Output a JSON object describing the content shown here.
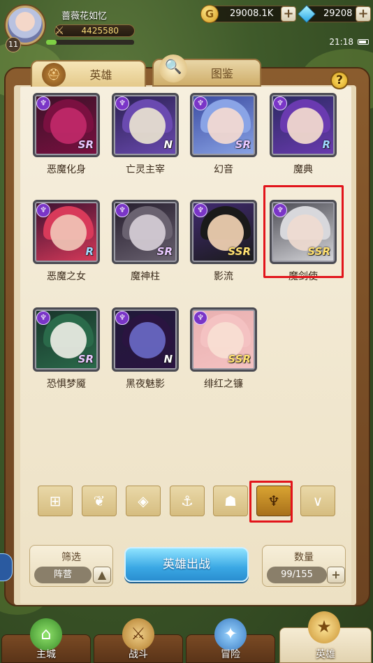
{
  "player": {
    "name": "蔷薇花如忆",
    "level": "11",
    "power": "4425580",
    "exp_fraction": 0.12
  },
  "resources": {
    "gold": "29008.1K",
    "gems": "29208"
  },
  "clock": "21:18",
  "tabs": {
    "hero": "英雄",
    "dex": "图鉴"
  },
  "help": "?",
  "heroes": [
    {
      "name": "恶魔化身",
      "rarity": "SR"
    },
    {
      "name": "亡灵主宰",
      "rarity": "N"
    },
    {
      "name": "幻音",
      "rarity": "SR"
    },
    {
      "name": "魔典",
      "rarity": "R"
    },
    {
      "name": "恶魔之女",
      "rarity": "R"
    },
    {
      "name": "魔神柱",
      "rarity": "SR"
    },
    {
      "name": "影流",
      "rarity": "SSR"
    },
    {
      "name": "魔剑使",
      "rarity": "SSR"
    },
    {
      "name": "恐惧梦魇",
      "rarity": "SR"
    },
    {
      "name": "黑夜魅影",
      "rarity": "N"
    },
    {
      "name": "绯红之镰",
      "rarity": "SSR"
    }
  ],
  "filter_icons": [
    "grid-icon",
    "leaf-icon",
    "diamond-icon",
    "anchor-icon",
    "beast-icon",
    "demon-horn-icon",
    "chevron-icon"
  ],
  "controls": {
    "filter_title": "筛选",
    "filter_value": "阵营",
    "deploy": "英雄出战",
    "count_title": "数量",
    "count_value": "99/155"
  },
  "nav": [
    "主城",
    "战斗",
    "冒险",
    "英雄"
  ],
  "colors": {
    "accent_red": "#e2141b",
    "deploy_blue": "#3aa8e4",
    "class_purple": "#7a35c7"
  }
}
